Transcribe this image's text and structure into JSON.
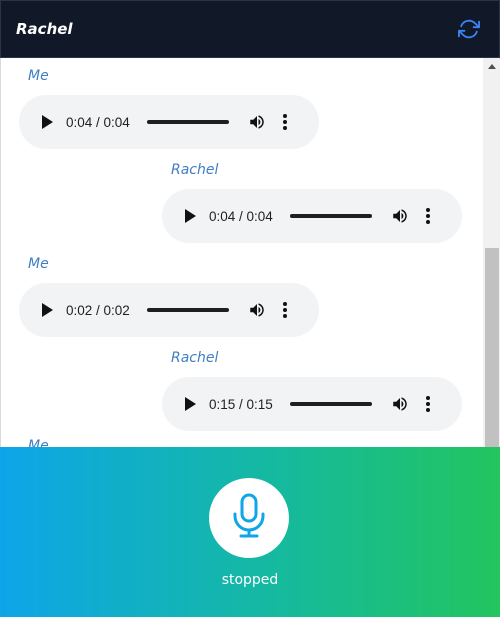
{
  "header": {
    "title": "Rachel",
    "refresh_icon": "refresh-icon"
  },
  "messages": [
    {
      "sender": "Me",
      "time": "0:04 / 0:04"
    },
    {
      "sender": "Rachel",
      "time": "0:04 / 0:04"
    },
    {
      "sender": "Me",
      "time": "0:02 / 0:02"
    },
    {
      "sender": "Rachel",
      "time": "0:15 / 0:15"
    }
  ],
  "partial_sender": "Me",
  "footer": {
    "status": "stopped",
    "mic_icon": "microphone-icon"
  },
  "colors": {
    "header_bg": "#111827",
    "sender": "#3f7fc2",
    "gradient_start": "#0ea5e9",
    "gradient_end": "#22c55e",
    "mic": "#0ea5e9"
  }
}
